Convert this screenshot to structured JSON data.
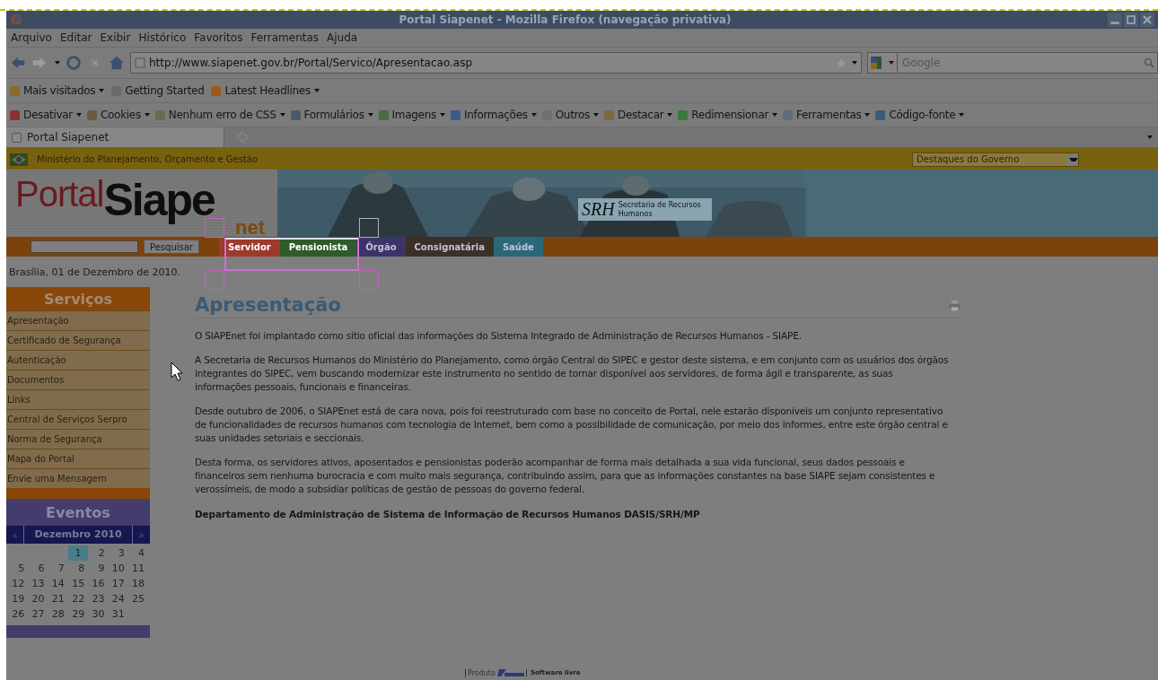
{
  "window": {
    "title": "Portal Siapenet - Mozilla Firefox (navegação privativa)"
  },
  "menu": [
    "Arquivo",
    "Editar",
    "Exibir",
    "Histórico",
    "Favoritos",
    "Ferramentas",
    "Ajuda"
  ],
  "address": "http://www.siapenet.gov.br/Portal/Servico/Apresentacao.asp",
  "search": {
    "placeholder": "Google"
  },
  "bookmarks": [
    {
      "label": "Mais visitados",
      "kind": "folder"
    },
    {
      "label": "Getting Started",
      "kind": "page"
    },
    {
      "label": "Latest Headlines",
      "kind": "feed"
    }
  ],
  "devtools": [
    "Desativar",
    "Cookies",
    "Nenhum erro de CSS",
    "Formulários",
    "Imagens",
    "Informações",
    "Outros",
    "Destacar",
    "Redimensionar",
    "Ferramentas",
    "Código-fonte"
  ],
  "tabs": [
    {
      "label": "Portal Siapenet",
      "selected": true
    }
  ],
  "gov_bar": {
    "label": "Ministério do Planejamento, Orçamento e Gestão",
    "select": "Destaques do Governo"
  },
  "logo": {
    "portal": "Portal",
    "siape": "Siape",
    "net": "net"
  },
  "srh": {
    "mark": "SRH",
    "name": "Secretaria de Recursos Humanos"
  },
  "site_search": {
    "button": "Pesquisar"
  },
  "nav": [
    {
      "label": "Servidor",
      "color": "#9e3a2c",
      "selected": true
    },
    {
      "label": "Pensionista",
      "color": "#2f5a2c",
      "selected": true
    },
    {
      "label": "Órgão",
      "color": "#3c3468",
      "selected": false
    },
    {
      "label": "Consignatária",
      "color": "#3a3028",
      "selected": false
    },
    {
      "label": "Saúde",
      "color": "#2a6878",
      "selected": false
    }
  ],
  "date": "Brasília, 01 de Dezembro de 2010.",
  "services": {
    "title": "Serviços",
    "items": [
      "Apresentação",
      "Certificado de Segurança",
      "Autenticação",
      "Documentos",
      "Links",
      "Central de Serviços Serpro",
      "Norma de Segurança",
      "Mapa do Portal",
      "Envie uma Mensagem"
    ]
  },
  "events": {
    "title": "Eventos",
    "prev": "«",
    "month": "Dezembro 2010",
    "next": "»",
    "weeks": [
      {
        "days": [
          {
            "day": "1",
            "selected": true
          },
          {
            "day": "2",
            "selected": false
          },
          {
            "day": "3",
            "selected": false
          },
          {
            "day": "4",
            "selected": false
          }
        ]
      },
      {
        "days": [
          {
            "day": "5",
            "selected": false
          },
          {
            "day": "6",
            "selected": false
          },
          {
            "day": "7",
            "selected": false
          },
          {
            "day": "8",
            "selected": false
          },
          {
            "day": "9",
            "selected": false
          },
          {
            "day": "10",
            "selected": false
          },
          {
            "day": "11",
            "selected": false
          }
        ]
      },
      {
        "days": [
          {
            "day": "12",
            "selected": false
          },
          {
            "day": "13",
            "selected": false
          },
          {
            "day": "14",
            "selected": false
          },
          {
            "day": "15",
            "selected": false
          },
          {
            "day": "16",
            "selected": false
          },
          {
            "day": "17",
            "selected": false
          },
          {
            "day": "18",
            "selected": false
          }
        ]
      },
      {
        "days": [
          {
            "day": "19",
            "selected": false
          },
          {
            "day": "20",
            "selected": false
          },
          {
            "day": "21",
            "selected": false
          },
          {
            "day": "22",
            "selected": false
          },
          {
            "day": "23",
            "selected": false
          },
          {
            "day": "24",
            "selected": false
          },
          {
            "day": "25",
            "selected": false
          }
        ]
      },
      {
        "days": [
          {
            "day": "26",
            "selected": false
          },
          {
            "day": "27",
            "selected": false
          },
          {
            "day": "28",
            "selected": false
          },
          {
            "day": "29",
            "selected": false
          },
          {
            "day": "30",
            "selected": false
          },
          {
            "day": "31",
            "selected": false
          }
        ]
      }
    ]
  },
  "article": {
    "title": "Apresentação",
    "paragraphs": [
      "O SIAPEnet foi implantado como sítio oficial das informações do Sistema Integrado de Administração de Recursos Humanos - SIAPE.",
      "A Secretaria de Recursos Humanos do Ministério do Planejamento, como órgão Central do SIPEC e gestor deste sistema, e em conjunto com os usuários dos órgãos integrantes do SIPEC, vem buscando modernizar este instrumento no sentido de tornar disponível aos servidores, de forma ágil e transparente, as suas informações pessoais, funcionais e financeiras.",
      "Desde outubro de 2006, o SIAPEnet está de cara nova, pois foi reestruturado com base no conceito de Portal, nele estarão disponíveis um conjunto representativo de funcionalidades de recursos humanos com tecnologia de Internet, bem como a possibilidade de comunicação, por meio dos informes, entre este órgão central e suas unidades setoriais e seccionais.",
      "Desta forma, os servidores ativos, aposentados e pensionistas poderão acompanhar de forma mais detalhada a sua vida funcional, seus dados pessoais e financeiros sem nenhuma burocracia e com muito mais segurança, contribuindo assim, para que as informações constantes na base SIAPE sejam consistentes e verossímeis, de modo a subsidiar políticas de gestão de pessoas do governo federal."
    ],
    "signature": "Departamento de Administração de Sistema de Informação de Recursos Humanos DASIS/SRH/MP"
  },
  "footer": {
    "product": "Produto",
    "license": "Software livre"
  }
}
